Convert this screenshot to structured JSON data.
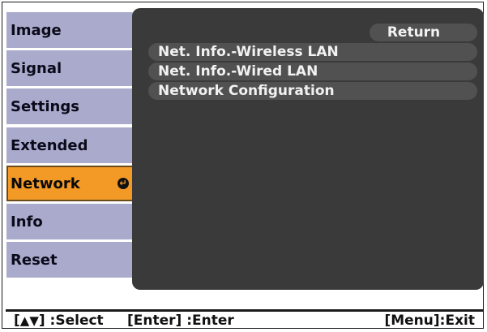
{
  "menu": {
    "items": [
      {
        "label": "Image"
      },
      {
        "label": "Signal"
      },
      {
        "label": "Settings"
      },
      {
        "label": "Extended"
      },
      {
        "label": "Network",
        "selected": true
      },
      {
        "label": "Info"
      },
      {
        "label": "Reset"
      }
    ]
  },
  "submenu": {
    "return_label": "Return",
    "items": [
      {
        "label": "Net. Info.-Wireless LAN"
      },
      {
        "label": "Net. Info.-Wired LAN"
      },
      {
        "label": "Network Configuration"
      }
    ]
  },
  "footer": {
    "select_bracket_open": "[",
    "select_icon": "▲▼",
    "select_text": "] :Select",
    "enter_hint": "[Enter] :Enter",
    "exit_hint": "[Menu]:Exit"
  },
  "colors": {
    "menu_item_bg": "#aaaacc",
    "menu_item_selected_bg": "#f39a26",
    "panel_bg": "#3a3a3a",
    "submenu_row_bg": "#515151",
    "submenu_text": "#f2f2f2"
  }
}
